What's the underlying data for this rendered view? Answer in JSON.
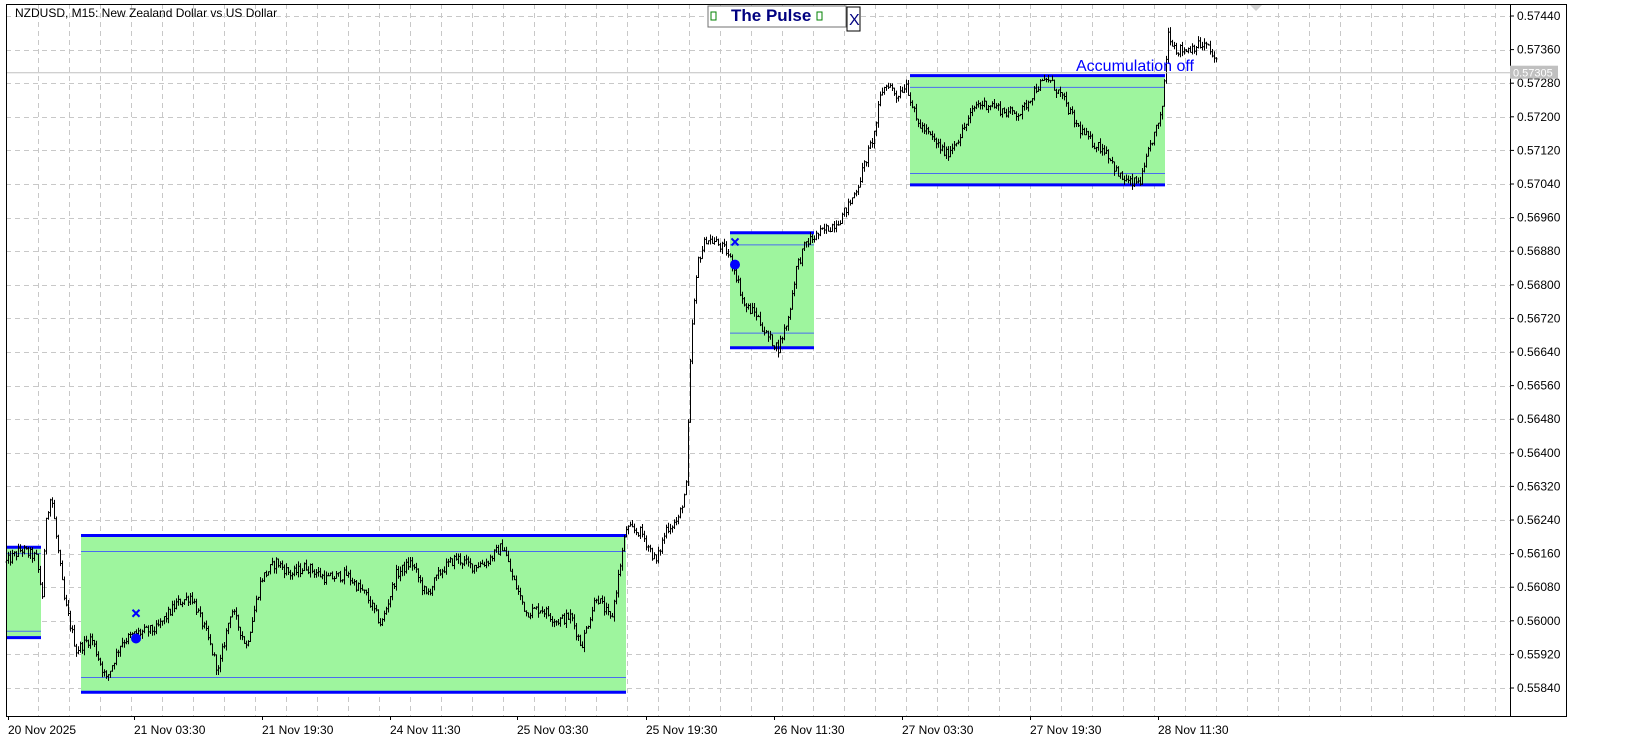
{
  "header": {
    "symbol_text": "NZDUSD, M15:  New Zealand Dollar vs US Dollar"
  },
  "panel": {
    "title": "The Pulse",
    "close_label": "X"
  },
  "annotation": {
    "accumulation_text": "Accumulation off"
  },
  "colors": {
    "zone_fill": "#9ef59e",
    "zone_border": "#0000ff",
    "candle": "#000000",
    "grid": "#c8c8c8",
    "current_price_tag": "#c0c0c0"
  },
  "chart_data": {
    "type": "candlestick",
    "symbol": "NZDUSD",
    "timeframe": "M15",
    "ylim": [
      0.5578,
      0.5746
    ],
    "y_ticks": [
      0.5744,
      0.5736,
      0.5728,
      0.572,
      0.5712,
      0.5704,
      0.5696,
      0.5688,
      0.568,
      0.5672,
      0.5664,
      0.5656,
      0.5648,
      0.564,
      0.5632,
      0.5624,
      0.5616,
      0.5608,
      0.56,
      0.5592,
      0.5584
    ],
    "y_tick_labels": [
      "0.57440",
      "0.57360",
      "0.57280",
      "0.57200",
      "0.57120",
      "0.57040",
      "0.56960",
      "0.56880",
      "0.56800",
      "0.56720",
      "0.56640",
      "0.56560",
      "0.56480",
      "0.56400",
      "0.56320",
      "0.56240",
      "0.56160",
      "0.56080",
      "0.56000",
      "0.55920",
      "0.55840"
    ],
    "x_tick_labels": [
      "20 Nov 2025",
      "21 Nov 03:30",
      "21 Nov 19:30",
      "24 Nov 11:30",
      "25 Nov 03:30",
      "25 Nov 19:30",
      "26 Nov 11:30",
      "27 Nov 03:30",
      "27 Nov 19:30",
      "28 Nov 11:30"
    ],
    "x_range": [
      0,
      1500
    ],
    "current_price": 0.57305,
    "current_price_label": "0.57305",
    "price_path": [
      [
        0,
        0.5614
      ],
      [
        15,
        0.5617
      ],
      [
        30,
        0.5615
      ],
      [
        36,
        0.5606
      ],
      [
        40,
        0.5625
      ],
      [
        45,
        0.563
      ],
      [
        50,
        0.562
      ],
      [
        58,
        0.5605
      ],
      [
        70,
        0.5593
      ],
      [
        85,
        0.5596
      ],
      [
        100,
        0.5586
      ],
      [
        115,
        0.5595
      ],
      [
        130,
        0.5597
      ],
      [
        150,
        0.5598
      ],
      [
        170,
        0.5604
      ],
      [
        185,
        0.5606
      ],
      [
        200,
        0.5597
      ],
      [
        212,
        0.5588
      ],
      [
        225,
        0.5603
      ],
      [
        240,
        0.5594
      ],
      [
        255,
        0.561
      ],
      [
        270,
        0.5614
      ],
      [
        285,
        0.5611
      ],
      [
        300,
        0.5613
      ],
      [
        320,
        0.561
      ],
      [
        340,
        0.5611
      ],
      [
        360,
        0.5606
      ],
      [
        375,
        0.5599
      ],
      [
        390,
        0.5611
      ],
      [
        405,
        0.5614
      ],
      [
        420,
        0.5606
      ],
      [
        435,
        0.5612
      ],
      [
        450,
        0.5615
      ],
      [
        465,
        0.5613
      ],
      [
        480,
        0.5614
      ],
      [
        497,
        0.5618
      ],
      [
        505,
        0.5611
      ],
      [
        520,
        0.5602
      ],
      [
        535,
        0.5603
      ],
      [
        550,
        0.56
      ],
      [
        565,
        0.5601
      ],
      [
        575,
        0.5594
      ],
      [
        590,
        0.5606
      ],
      [
        605,
        0.56
      ],
      [
        615,
        0.5615
      ],
      [
        620,
        0.5622
      ],
      [
        635,
        0.5621
      ],
      [
        650,
        0.5614
      ],
      [
        660,
        0.5622
      ],
      [
        672,
        0.5624
      ],
      [
        680,
        0.5632
      ],
      [
        685,
        0.5668
      ],
      [
        692,
        0.5686
      ],
      [
        700,
        0.5691
      ],
      [
        710,
        0.569
      ],
      [
        720,
        0.5688
      ],
      [
        728,
        0.5684
      ],
      [
        738,
        0.5675
      ],
      [
        750,
        0.5673
      ],
      [
        760,
        0.5668
      ],
      [
        772,
        0.5665
      ],
      [
        782,
        0.5672
      ],
      [
        790,
        0.5684
      ],
      [
        800,
        0.569
      ],
      [
        812,
        0.5692
      ],
      [
        825,
        0.5694
      ],
      [
        835,
        0.5696
      ],
      [
        845,
        0.57
      ],
      [
        852,
        0.5704
      ],
      [
        860,
        0.571
      ],
      [
        868,
        0.5716
      ],
      [
        875,
        0.5726
      ],
      [
        882,
        0.5728
      ],
      [
        890,
        0.5725
      ],
      [
        900,
        0.5728
      ],
      [
        910,
        0.5719
      ],
      [
        925,
        0.5715
      ],
      [
        940,
        0.5711
      ],
      [
        955,
        0.5716
      ],
      [
        970,
        0.5723
      ],
      [
        985,
        0.5723
      ],
      [
        1000,
        0.5721
      ],
      [
        1015,
        0.5721
      ],
      [
        1030,
        0.5727
      ],
      [
        1042,
        0.5729
      ],
      [
        1055,
        0.5725
      ],
      [
        1070,
        0.5718
      ],
      [
        1085,
        0.5714
      ],
      [
        1100,
        0.5712
      ],
      [
        1112,
        0.5706
      ],
      [
        1125,
        0.5704
      ],
      [
        1135,
        0.5705
      ],
      [
        1145,
        0.5714
      ],
      [
        1155,
        0.572
      ],
      [
        1162,
        0.574
      ],
      [
        1170,
        0.5736
      ],
      [
        1180,
        0.5736
      ],
      [
        1190,
        0.5737
      ],
      [
        1200,
        0.5737
      ],
      [
        1210,
        0.5733
      ]
    ],
    "zones": [
      {
        "x_start": 0,
        "x_end": 35,
        "top": 0.56175,
        "upper_inner": 0.5616,
        "lower_inner": 0.55975,
        "bottom": 0.5596
      },
      {
        "x_start": 75,
        "x_end": 620,
        "top": 0.56203,
        "upper_inner": 0.56165,
        "lower_inner": 0.55865,
        "bottom": 0.5583
      },
      {
        "x_start": 724,
        "x_end": 808,
        "top": 0.56924,
        "upper_inner": 0.56895,
        "lower_inner": 0.56685,
        "bottom": 0.5665
      },
      {
        "x_start": 904,
        "x_end": 1159,
        "top": 0.57298,
        "upper_inner": 0.5727,
        "lower_inner": 0.57065,
        "bottom": 0.57038
      }
    ],
    "signals": [
      {
        "type": "cross",
        "x": 130,
        "y": 0.56018
      },
      {
        "type": "dot",
        "x": 130,
        "y": 0.55958
      },
      {
        "type": "cross",
        "x": 729,
        "y": 0.56902
      },
      {
        "type": "dot",
        "x": 729,
        "y": 0.56848
      }
    ]
  }
}
